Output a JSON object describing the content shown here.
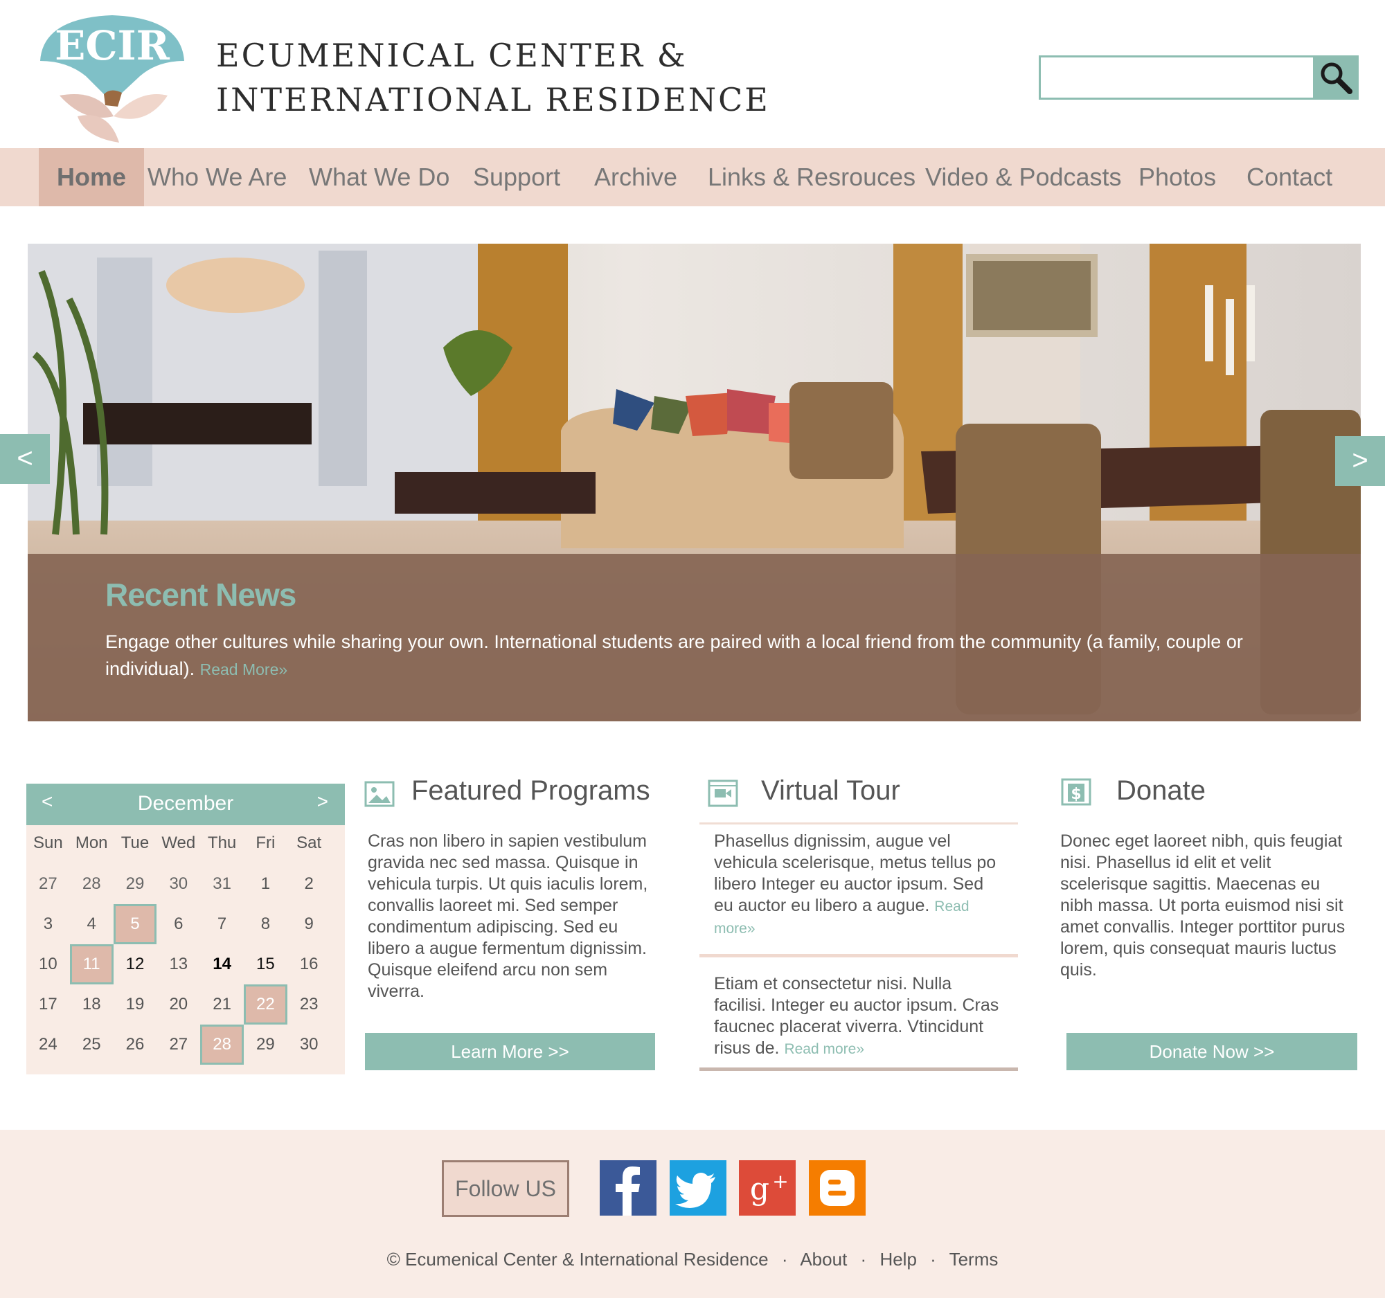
{
  "header": {
    "logo_text": "ECIR",
    "title_line1": "ECUMENICAL CENTER &",
    "title_line2": "INTERNATIONAL RESIDENCE",
    "search_placeholder": ""
  },
  "nav": {
    "items": [
      "Home",
      "Who We Are",
      "What We Do",
      "Support",
      "Archive",
      "Links & Resrouces",
      "Video & Podcasts",
      "Photos",
      "Contact"
    ],
    "active": "Home"
  },
  "hero": {
    "prev": "<",
    "next": ">",
    "news_title": "Recent News",
    "news_text": "Engage other cultures while sharing your own. International students are paired with a local friend from the community (a family, couple or individual).",
    "read_more": "Read More»"
  },
  "calendar": {
    "prev": "<",
    "next": ">",
    "month": "December",
    "weekdays": [
      "Sun",
      "Mon",
      "Tue",
      "Wed",
      "Thu",
      "Fri",
      "Sat"
    ],
    "weeks": [
      [
        "27",
        "28",
        "29",
        "30",
        "31",
        "1",
        "2"
      ],
      [
        "3",
        "4",
        "5",
        "6",
        "7",
        "8",
        "9"
      ],
      [
        "10",
        "11",
        "12",
        "13",
        "14",
        "15",
        "16"
      ],
      [
        "17",
        "18",
        "19",
        "20",
        "21",
        "22",
        "23"
      ],
      [
        "24",
        "25",
        "26",
        "27",
        "28",
        "29",
        "30"
      ]
    ]
  },
  "featured": {
    "title": "Featured Programs",
    "text": "Cras non libero in sapien vestibulum gravida nec sed massa. Quisque in vehicula turpis. Ut quis iaculis lorem, convallis laoreet mi. Sed semper condimentum adipiscing. Sed eu libero a augue fermentum dignissim. Quisque eleifend arcu non sem viverra.",
    "button": "Learn More >>"
  },
  "tour": {
    "title": "Virtual Tour",
    "text1": "Phasellus dignissim, augue vel vehicula scelerisque, metus tellus po libero Integer eu auctor ipsum. Sed eu auctor eu libero a augue.",
    "read_more1": "Read more»",
    "text2": "Etiam et consectetur nisi. Nulla facilisi. Integer eu auctor ipsum. Cras faucnec placerat viverra. Vtincidunt risus de.",
    "read_more2": "Read more»"
  },
  "donate": {
    "title": "Donate",
    "text": "Donec eget laoreet nibh, quis feugiat nisi. Phasellus id elit et velit scelerisque sagittis. Maecenas eu nibh massa. Ut porta euismod nisi sit amet convallis. Integer porttitor purus lorem, quis consequat mauris luctus quis.",
    "button": "Donate Now >>"
  },
  "footer": {
    "follow": "Follow US",
    "social": [
      "facebook-icon",
      "twitter-icon",
      "google-plus-icon",
      "blogger-icon"
    ],
    "copyright": "© Ecumenical Center & International Residence",
    "sep": "·",
    "links": [
      "About",
      "Help",
      "Terms"
    ]
  },
  "colors": {
    "accent": "#8dbdb1",
    "nav_bg": "#f0d9cf",
    "overlay": "#856554",
    "footer_bg": "#f9ece6"
  }
}
